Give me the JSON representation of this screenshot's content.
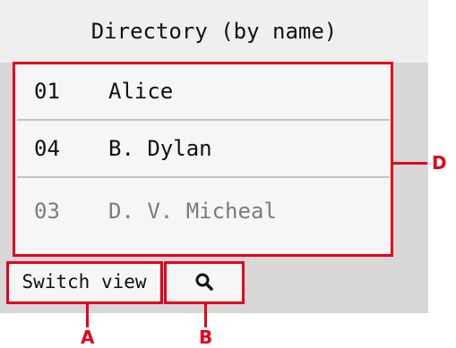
{
  "header": {
    "title": "Directory (by name)"
  },
  "directory": {
    "entries": [
      {
        "number": "01",
        "name": "Alice"
      },
      {
        "number": "04",
        "name": "B. Dylan"
      },
      {
        "number": "03",
        "name": "D. V. Micheal"
      }
    ]
  },
  "toolbar": {
    "switch_view_label": "Switch view",
    "search_icon": "search-icon"
  },
  "annotations": {
    "a": "A",
    "b": "B",
    "d": "D"
  },
  "colors": {
    "callout": "#e4001b",
    "screen_bg": "#d7d7d7",
    "panel_bg": "#f6f6f6"
  }
}
